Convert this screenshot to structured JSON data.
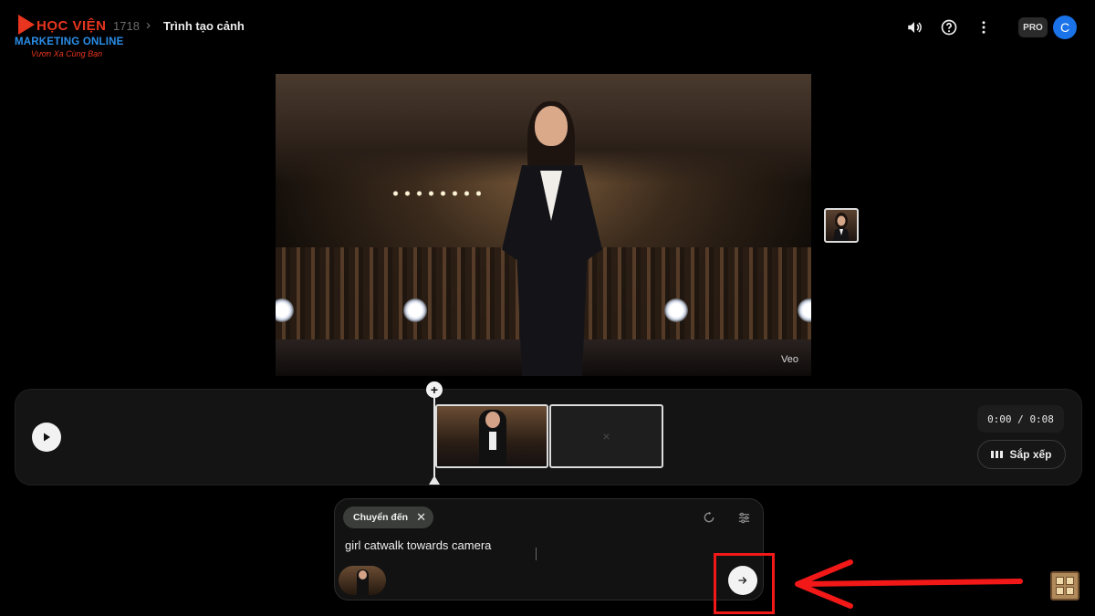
{
  "header": {
    "logo": {
      "line1": "HỌC VIỆN",
      "line2": "MARKETING ONLINE",
      "line3": "Vươn Xa Cùng Bạn"
    },
    "breadcrumb": {
      "project_id": "1718",
      "title": "Trình tạo cảnh"
    },
    "icons": [
      "volume-icon",
      "help-icon",
      "more-vert-icon"
    ],
    "pro_badge": "PRO",
    "avatar_letter": "C"
  },
  "preview": {
    "watermark": "Veo"
  },
  "timeline": {
    "current_time": "0:00",
    "total_time": "0:08",
    "time_display": "0:00 / 0:08",
    "arrange_label": "Sắp xếp",
    "empty_clip_mark": "×"
  },
  "prompt": {
    "chip_label": "Chuyển đến",
    "text": "girl catwalk towards camera"
  },
  "colors": {
    "background": "#000000",
    "accent_blue": "#1a73e8",
    "annotation_red": "#f21818"
  }
}
